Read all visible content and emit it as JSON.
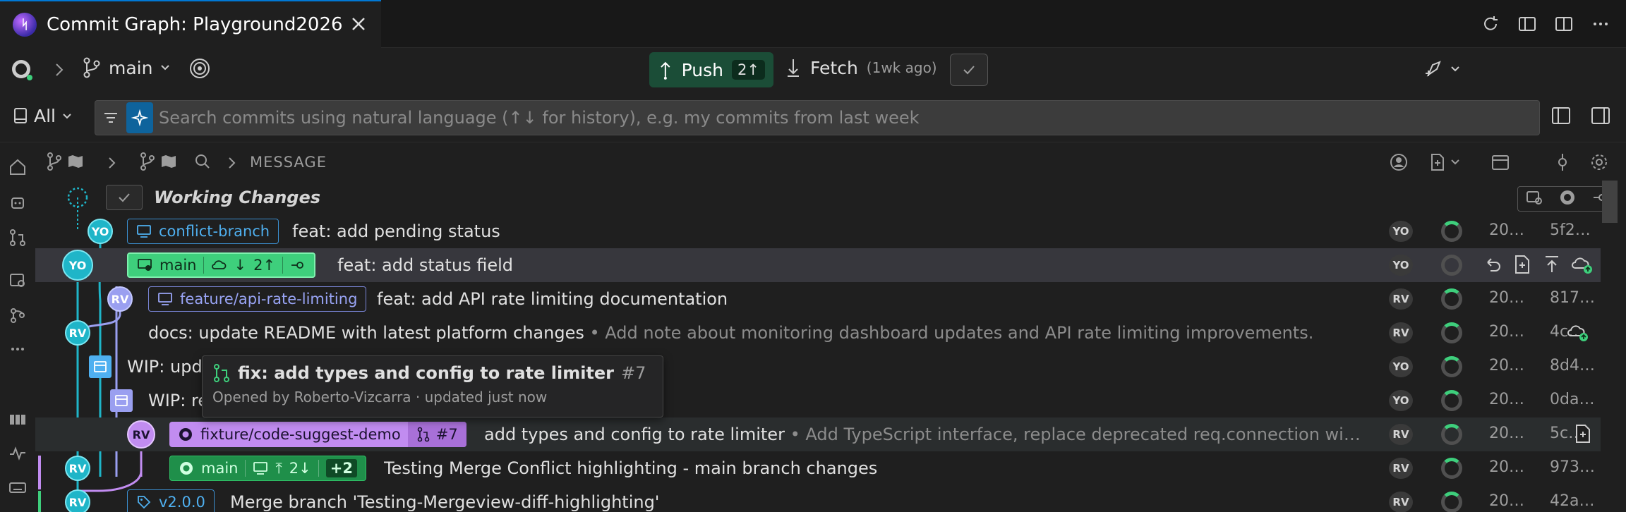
{
  "tab": {
    "title": "Commit Graph: Playground2026"
  },
  "toolbar": {
    "branch": "main",
    "push_label": "Push",
    "push_count": "2↑",
    "fetch_label": "Fetch",
    "fetch_ago": "(1wk ago)"
  },
  "search": {
    "scope": "All",
    "placeholder": "Search commits using natural language (↑↓ for history), e.g. my commits from last week"
  },
  "graph_header": {
    "message": "MESSAGE"
  },
  "working_changes": "Working Changes",
  "rows": [
    {
      "branch": "conflict-branch",
      "message": "feat: add pending status",
      "author": "YO",
      "date": "20…",
      "sha": "5f2…"
    },
    {
      "branch": "main",
      "badge": "2↑",
      "message": "feat: add status field",
      "author": "YO"
    },
    {
      "branch": "feature/api-rate-limiting",
      "message": "feat: add API rate limiting documentation",
      "author": "RV",
      "date": "20…",
      "sha": "817…"
    },
    {
      "message": "docs: update README with latest platform changes",
      "description": "• Add note about monitoring dashboard updates and API rate limiting improvements.",
      "author": "RV",
      "date": "20…",
      "sha": "4c…"
    },
    {
      "message": "WIP: upd",
      "author": "YO",
      "date": "20…",
      "sha": "8d4…"
    },
    {
      "message": "WIP: re",
      "author": "YO",
      "date": "20…",
      "sha": "0da…"
    },
    {
      "branch": "fixture/code-suggest-demo",
      "pr": "#7",
      "message": "add types and config to rate limiter",
      "description": "• Add TypeScript interface, replace deprecated req.connection wi…",
      "author": "RV",
      "date": "20…",
      "sha": "5c…"
    },
    {
      "branch": "main",
      "badge": "2↓",
      "extra": "+2",
      "message": "Testing Merge Conflict highlighting - main branch changes",
      "author": "RV",
      "date": "20…",
      "sha": "973…"
    },
    {
      "tag": "v2.0.0",
      "message": "Merge branch 'Testing-Mergeview-diff-highlighting'",
      "author": "RV",
      "date": "20…",
      "sha": "42a…"
    }
  ],
  "tooltip": {
    "title": "fix: add types and config to rate limiter",
    "number": "#7",
    "subtitle": "Opened by Roberto-Vizcarra · updated just now"
  },
  "colors": {
    "accent": "#0078d4",
    "push_bg": "#1b4d37",
    "main_branch": "#3ecf7c",
    "fixture_branch": "#c18cf0",
    "local_branch": "#3b8ecf"
  }
}
